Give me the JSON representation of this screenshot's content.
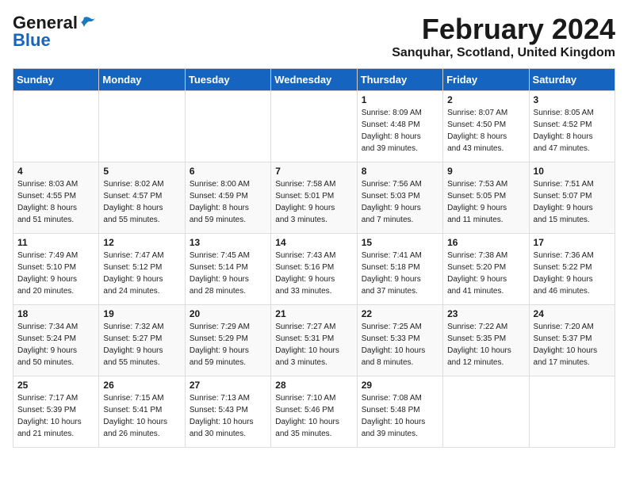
{
  "logo": {
    "line1": "General",
    "line2": "Blue"
  },
  "title": "February 2024",
  "subtitle": "Sanquhar, Scotland, United Kingdom",
  "days_header": [
    "Sunday",
    "Monday",
    "Tuesday",
    "Wednesday",
    "Thursday",
    "Friday",
    "Saturday"
  ],
  "weeks": [
    [
      {
        "num": "",
        "info": ""
      },
      {
        "num": "",
        "info": ""
      },
      {
        "num": "",
        "info": ""
      },
      {
        "num": "",
        "info": ""
      },
      {
        "num": "1",
        "info": "Sunrise: 8:09 AM\nSunset: 4:48 PM\nDaylight: 8 hours\nand 39 minutes."
      },
      {
        "num": "2",
        "info": "Sunrise: 8:07 AM\nSunset: 4:50 PM\nDaylight: 8 hours\nand 43 minutes."
      },
      {
        "num": "3",
        "info": "Sunrise: 8:05 AM\nSunset: 4:52 PM\nDaylight: 8 hours\nand 47 minutes."
      }
    ],
    [
      {
        "num": "4",
        "info": "Sunrise: 8:03 AM\nSunset: 4:55 PM\nDaylight: 8 hours\nand 51 minutes."
      },
      {
        "num": "5",
        "info": "Sunrise: 8:02 AM\nSunset: 4:57 PM\nDaylight: 8 hours\nand 55 minutes."
      },
      {
        "num": "6",
        "info": "Sunrise: 8:00 AM\nSunset: 4:59 PM\nDaylight: 8 hours\nand 59 minutes."
      },
      {
        "num": "7",
        "info": "Sunrise: 7:58 AM\nSunset: 5:01 PM\nDaylight: 9 hours\nand 3 minutes."
      },
      {
        "num": "8",
        "info": "Sunrise: 7:56 AM\nSunset: 5:03 PM\nDaylight: 9 hours\nand 7 minutes."
      },
      {
        "num": "9",
        "info": "Sunrise: 7:53 AM\nSunset: 5:05 PM\nDaylight: 9 hours\nand 11 minutes."
      },
      {
        "num": "10",
        "info": "Sunrise: 7:51 AM\nSunset: 5:07 PM\nDaylight: 9 hours\nand 15 minutes."
      }
    ],
    [
      {
        "num": "11",
        "info": "Sunrise: 7:49 AM\nSunset: 5:10 PM\nDaylight: 9 hours\nand 20 minutes."
      },
      {
        "num": "12",
        "info": "Sunrise: 7:47 AM\nSunset: 5:12 PM\nDaylight: 9 hours\nand 24 minutes."
      },
      {
        "num": "13",
        "info": "Sunrise: 7:45 AM\nSunset: 5:14 PM\nDaylight: 9 hours\nand 28 minutes."
      },
      {
        "num": "14",
        "info": "Sunrise: 7:43 AM\nSunset: 5:16 PM\nDaylight: 9 hours\nand 33 minutes."
      },
      {
        "num": "15",
        "info": "Sunrise: 7:41 AM\nSunset: 5:18 PM\nDaylight: 9 hours\nand 37 minutes."
      },
      {
        "num": "16",
        "info": "Sunrise: 7:38 AM\nSunset: 5:20 PM\nDaylight: 9 hours\nand 41 minutes."
      },
      {
        "num": "17",
        "info": "Sunrise: 7:36 AM\nSunset: 5:22 PM\nDaylight: 9 hours\nand 46 minutes."
      }
    ],
    [
      {
        "num": "18",
        "info": "Sunrise: 7:34 AM\nSunset: 5:24 PM\nDaylight: 9 hours\nand 50 minutes."
      },
      {
        "num": "19",
        "info": "Sunrise: 7:32 AM\nSunset: 5:27 PM\nDaylight: 9 hours\nand 55 minutes."
      },
      {
        "num": "20",
        "info": "Sunrise: 7:29 AM\nSunset: 5:29 PM\nDaylight: 9 hours\nand 59 minutes."
      },
      {
        "num": "21",
        "info": "Sunrise: 7:27 AM\nSunset: 5:31 PM\nDaylight: 10 hours\nand 3 minutes."
      },
      {
        "num": "22",
        "info": "Sunrise: 7:25 AM\nSunset: 5:33 PM\nDaylight: 10 hours\nand 8 minutes."
      },
      {
        "num": "23",
        "info": "Sunrise: 7:22 AM\nSunset: 5:35 PM\nDaylight: 10 hours\nand 12 minutes."
      },
      {
        "num": "24",
        "info": "Sunrise: 7:20 AM\nSunset: 5:37 PM\nDaylight: 10 hours\nand 17 minutes."
      }
    ],
    [
      {
        "num": "25",
        "info": "Sunrise: 7:17 AM\nSunset: 5:39 PM\nDaylight: 10 hours\nand 21 minutes."
      },
      {
        "num": "26",
        "info": "Sunrise: 7:15 AM\nSunset: 5:41 PM\nDaylight: 10 hours\nand 26 minutes."
      },
      {
        "num": "27",
        "info": "Sunrise: 7:13 AM\nSunset: 5:43 PM\nDaylight: 10 hours\nand 30 minutes."
      },
      {
        "num": "28",
        "info": "Sunrise: 7:10 AM\nSunset: 5:46 PM\nDaylight: 10 hours\nand 35 minutes."
      },
      {
        "num": "29",
        "info": "Sunrise: 7:08 AM\nSunset: 5:48 PM\nDaylight: 10 hours\nand 39 minutes."
      },
      {
        "num": "",
        "info": ""
      },
      {
        "num": "",
        "info": ""
      }
    ]
  ]
}
